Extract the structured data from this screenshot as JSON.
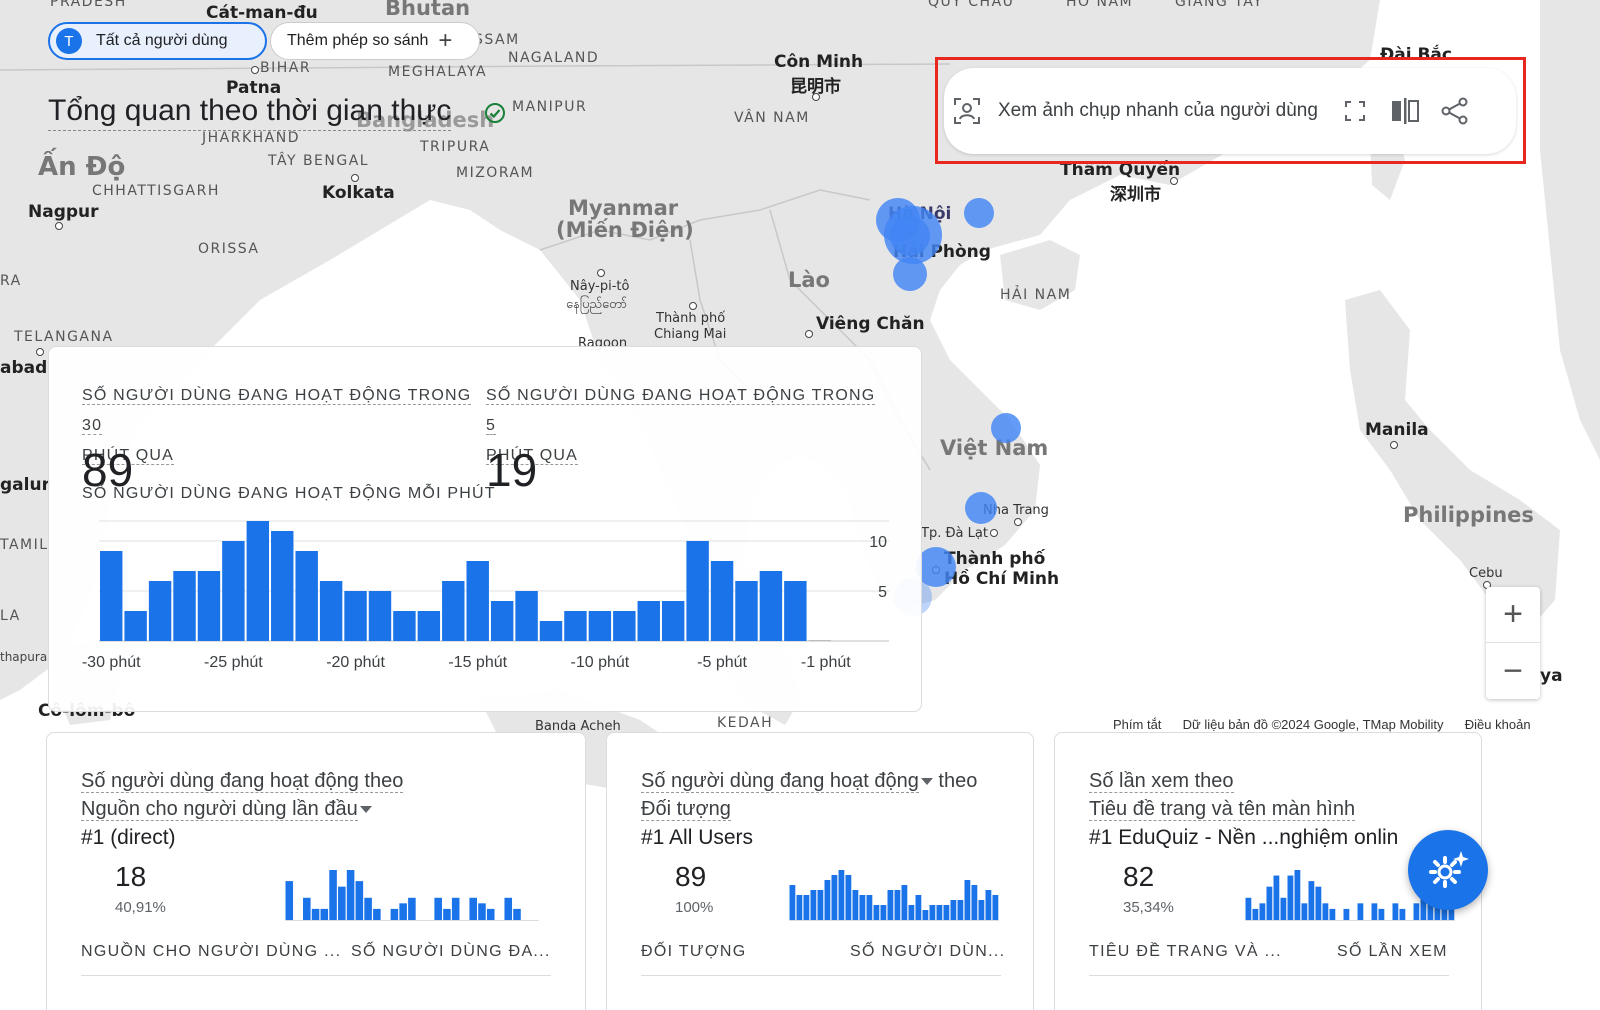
{
  "filters": {
    "all_users_avatar": "T",
    "all_users_label": "Tất cả người dùng",
    "add_comparison_label": "Thêm phép so sánh"
  },
  "page_title": "Tổng quan theo thời gian thực",
  "snapshot_bar": {
    "label": "Xem ảnh chụp nhanh của người dùng"
  },
  "map": {
    "labels": [
      {
        "text": "PRADESH",
        "style": "caps"
      },
      {
        "text": "Cát-man-đu",
        "style": "city"
      },
      {
        "text": "Bhutan",
        "style": "country"
      },
      {
        "text": "QUÝ CHÂU",
        "style": "caps"
      },
      {
        "text": "HỒ NAM",
        "style": "caps"
      },
      {
        "text": "GIANG TÂY",
        "style": "caps"
      },
      {
        "text": "Đài Bắc",
        "style": "city"
      },
      {
        "text": "SSAM",
        "style": "caps"
      },
      {
        "text": "NAGALAND",
        "style": "caps"
      },
      {
        "text": "BIHAR",
        "style": "caps"
      },
      {
        "text": "MEGHALAYA",
        "style": "caps"
      },
      {
        "text": "Côn Minh",
        "style": "city"
      },
      {
        "text": "昆明市",
        "style": "city"
      },
      {
        "text": "Patna",
        "style": "city"
      },
      {
        "text": "MANIPUR",
        "style": "caps"
      },
      {
        "text": "Bangladesh",
        "style": "country"
      },
      {
        "text": "VÂN NAM",
        "style": "caps"
      },
      {
        "text": "JHARKHAND",
        "style": "caps"
      },
      {
        "text": "TRIPURA",
        "style": "caps"
      },
      {
        "text": "Ấn Độ",
        "style": "country"
      },
      {
        "text": "TÂY BENGAL",
        "style": "caps"
      },
      {
        "text": "Thâm Quyến",
        "style": "city"
      },
      {
        "text": "深圳市",
        "style": "city"
      },
      {
        "text": "MIZORAM",
        "style": "caps"
      },
      {
        "text": "CHHATTISGARH",
        "style": "caps"
      },
      {
        "text": "Kolkata",
        "style": "city"
      },
      {
        "text": "Nagpur",
        "style": "city"
      },
      {
        "text": "Myanmar",
        "style": "country"
      },
      {
        "text": "(Miến Điện)",
        "style": "country"
      },
      {
        "text": "Hà Nội",
        "style": "city"
      },
      {
        "text": "Hải Phòng",
        "style": "city"
      },
      {
        "text": "ORISSA",
        "style": "caps"
      },
      {
        "text": "RA",
        "style": "caps"
      },
      {
        "text": "Lào",
        "style": "country"
      },
      {
        "text": "Nây-pi-tô",
        "style": "small"
      },
      {
        "text": "နေပြည်တော်",
        "style": "small"
      },
      {
        "text": "HẢI NAM",
        "style": "caps"
      },
      {
        "text": "Thành phố",
        "style": "small"
      },
      {
        "text": "Chiang Mai",
        "style": "small"
      },
      {
        "text": "Viêng Chăn",
        "style": "city"
      },
      {
        "text": "TELANGANA",
        "style": "caps"
      },
      {
        "text": "Ragoon",
        "style": "small"
      },
      {
        "text": "abad",
        "style": "city"
      },
      {
        "text": "Việt Nam",
        "style": "country"
      },
      {
        "text": "Manila",
        "style": "city"
      },
      {
        "text": "Nha Trang",
        "style": "small"
      },
      {
        "text": "Philippines",
        "style": "country"
      },
      {
        "text": "Tp. Đà Lạt",
        "style": "small"
      },
      {
        "text": "Thành phố",
        "style": "city"
      },
      {
        "text": "Hồ Chí Minh",
        "style": "city"
      },
      {
        "text": "TAMIL",
        "style": "caps"
      },
      {
        "text": "Cebu",
        "style": "small"
      },
      {
        "text": "LA",
        "style": "caps"
      },
      {
        "text": "galur",
        "style": "city"
      },
      {
        "text": "thapura",
        "style": "tiny"
      },
      {
        "text": "Cô-lôm-bô",
        "style": "city"
      },
      {
        "text": "Banda Acheh",
        "style": "small"
      },
      {
        "text": "KEDAH",
        "style": "caps"
      },
      {
        "text": "ya",
        "style": "city"
      }
    ],
    "attribution": {
      "shortcuts": "Phím tắt",
      "map_data": "Dữ liệu bản đồ ©2024 Google, TMap Mobility",
      "terms": "Điều khoản"
    },
    "zoom_in": "+",
    "zoom_out": "−"
  },
  "realtime_card": {
    "metric_30": {
      "label_line1": "SỐ NGƯỜI DÙNG ĐANG HOẠT ĐỘNG TRONG 30",
      "label_line2": "PHÚT QUA",
      "value": "89"
    },
    "metric_5": {
      "label_line1": "SỐ NGƯỜI DÙNG ĐANG HOẠT ĐỘNG TRONG 5",
      "label_line2": "PHÚT QUA",
      "value": "19"
    },
    "per_minute_label": "SỐ NGƯỜI DÙNG ĐANG HOẠT ĐỘNG MỖI PHÚT"
  },
  "chart_data": {
    "type": "bar",
    "title": "SỐ NGƯỜI DÙNG ĐANG HOẠT ĐỘNG MỖI PHÚT",
    "x_tick_labels": [
      "-30 phút",
      "-25 phút",
      "-20 phút",
      "-15 phút",
      "-10 phút",
      "-5 phút",
      "-1 phút"
    ],
    "y_tick_labels": [
      "5",
      "10"
    ],
    "ylim": [
      0,
      12
    ],
    "values": [
      9,
      3,
      6,
      7,
      7,
      10,
      12,
      11,
      9,
      6,
      5,
      5,
      3,
      3,
      6,
      8,
      4,
      5,
      2,
      3,
      3,
      3,
      4,
      4,
      10,
      8,
      6,
      7,
      6,
      0
    ],
    "bar_color": "#1a73e8",
    "grid": true
  },
  "cards": [
    {
      "title_line1": "Số người dùng đang hoạt động theo",
      "title_line2": "Nguồn cho người dùng lần đầu",
      "top_item": "#1  (direct)",
      "value": "18",
      "percent": "40,91%",
      "col1": "NGUỒN CHO NGƯỜI DÙNG ...",
      "col2": "SỐ NGƯỜI DÙNG ĐA...",
      "spark": [
        7,
        0,
        4,
        2,
        2,
        9,
        6,
        9,
        7,
        4,
        2,
        0,
        2,
        3,
        4,
        0,
        0,
        4,
        2,
        4,
        0,
        4,
        3,
        2,
        0,
        4,
        2,
        0,
        0
      ]
    },
    {
      "title_line1": "Số người dùng đang hoạt động",
      "title_line1b": "theo",
      "title_line2": "Đối tượng",
      "top_item": "#1  All Users",
      "value": "89",
      "percent": "100%",
      "col1": "ĐỐI TƯỢNG",
      "col2": "SỐ NGƯỜI DÙN...",
      "spark": [
        7,
        5,
        5,
        6,
        6,
        8,
        9,
        10,
        9,
        6,
        5,
        5,
        3,
        3,
        6,
        6,
        7,
        3,
        5,
        2,
        3,
        3,
        3,
        4,
        4,
        8,
        7,
        4,
        6,
        5
      ]
    },
    {
      "title_line1": "Số lần xem theo",
      "title_line2": "Tiêu đề trang và tên màn hình",
      "top_item": "#1  EduQuiz - Nền ...nghiệm onlin",
      "value": "82",
      "percent": "35,34%",
      "col1": "TIÊU ĐỀ TRANG VÀ ...",
      "col2": "SỐ LẦN XEM",
      "spark": [
        4,
        2,
        3,
        6,
        8,
        4,
        8,
        9,
        3,
        7,
        6,
        3,
        2,
        0,
        2,
        0,
        3,
        0,
        3,
        2,
        0,
        3,
        2,
        0,
        3,
        4,
        4,
        6,
        5,
        3
      ]
    }
  ],
  "colors": {
    "accent": "#1a73e8",
    "highlight_box": "#e8281e",
    "map_water": "#ffffff",
    "map_land": "#e7e7e7",
    "user_dot": "#4285f4"
  }
}
